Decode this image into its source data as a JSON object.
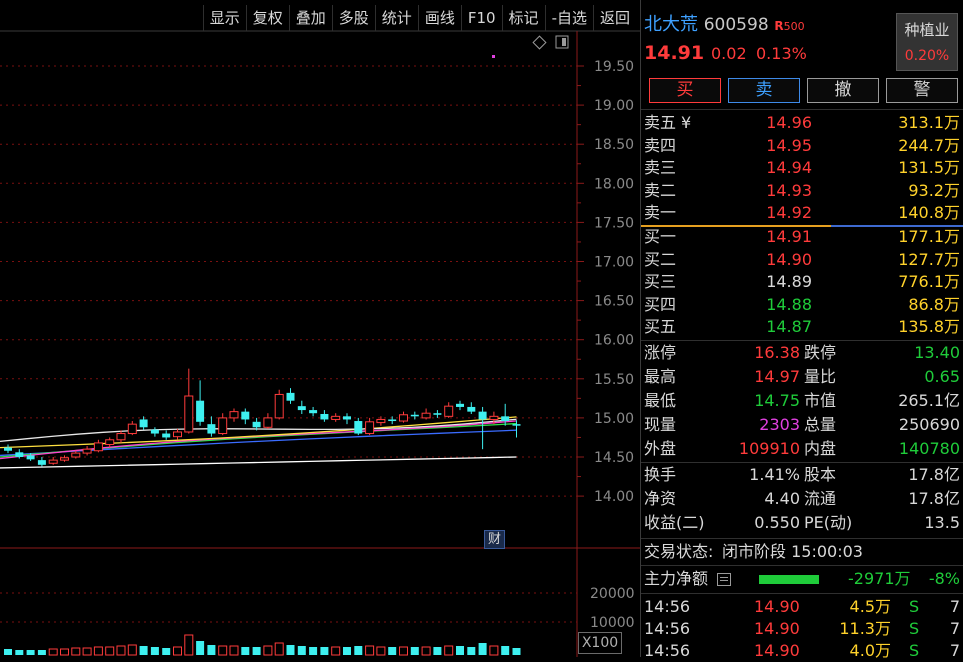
{
  "toolbar": {
    "items": [
      "显示",
      "复权",
      "叠加",
      "多股",
      "统计",
      "画线",
      "F10",
      "标记",
      "-自选",
      "返回"
    ]
  },
  "chart": {
    "price_axis": [
      "19.50",
      "19.00",
      "18.50",
      "18.00",
      "17.50",
      "17.00",
      "16.50",
      "16.00",
      "15.50",
      "15.00",
      "14.50",
      "14.00"
    ],
    "vol_axis": [
      "20000",
      "10000"
    ],
    "vol_unit": "X100",
    "badge": "财",
    "colors": {
      "up": "#ff3b3b",
      "down": "#3ef0f0"
    }
  },
  "quote": {
    "name": "北大荒",
    "code": "600598",
    "tag": "R",
    "tag_num": "500",
    "price": "14.91",
    "change": "0.02",
    "change_pct": "0.13%",
    "sector_name": "种植业",
    "sector_pct": "0.20%"
  },
  "actions": {
    "buy": "买",
    "sell": "卖",
    "cancel": "撤",
    "alert": "警"
  },
  "ask": [
    {
      "label": "卖五",
      "extra": "¥",
      "price": "14.96",
      "vol": "313.1万"
    },
    {
      "label": "卖四",
      "extra": "",
      "price": "14.95",
      "vol": "244.7万"
    },
    {
      "label": "卖三",
      "extra": "",
      "price": "14.94",
      "vol": "131.5万"
    },
    {
      "label": "卖二",
      "extra": "",
      "price": "14.93",
      "vol": "93.2万"
    },
    {
      "label": "卖一",
      "extra": "",
      "price": "14.92",
      "vol": "140.8万"
    }
  ],
  "bid": [
    {
      "label": "买一",
      "price": "14.91",
      "vol": "177.1万"
    },
    {
      "label": "买二",
      "price": "14.90",
      "vol": "127.7万"
    },
    {
      "label": "买三",
      "price": "14.89",
      "vol": "776.1万"
    },
    {
      "label": "买四",
      "price": "14.88",
      "vol": "86.8万"
    },
    {
      "label": "买五",
      "price": "14.87",
      "vol": "135.8万"
    }
  ],
  "stats": [
    {
      "l1": "涨停",
      "v1": "16.38",
      "l2": "跌停",
      "v2": "13.40"
    },
    {
      "l1": "最高",
      "v1": "14.97",
      "l2": "量比",
      "v2": "0.65"
    },
    {
      "l1": "最低",
      "v1": "14.75",
      "l2": "市值",
      "v2": "265.1亿"
    },
    {
      "l1": "现量",
      "v1": "2303",
      "l2": "总量",
      "v2": "250690"
    },
    {
      "l1": "外盘",
      "v1": "109910",
      "l2": "内盘",
      "v2": "140780"
    }
  ],
  "fundamentals": [
    {
      "l1": "换手",
      "v1": "1.41%",
      "l2": "股本",
      "v2": "17.8亿"
    },
    {
      "l1": "净资",
      "v1": "4.40",
      "l2": "流通",
      "v2": "17.8亿"
    },
    {
      "l1": "收益(二)",
      "v1": "0.550",
      "l2": "PE(动)",
      "v2": "13.5"
    }
  ],
  "status": {
    "label": "交易状态:",
    "value": "闭市阶段 15:00:03"
  },
  "mainforce": {
    "label": "主力净额",
    "value": "-2971万",
    "pct": "-8%"
  },
  "ticks": [
    {
      "time": "14:56",
      "price": "14.90",
      "vol": "4.5万",
      "side": "S",
      "num": "7"
    },
    {
      "time": "14:56",
      "price": "14.90",
      "vol": "11.3万",
      "side": "S",
      "num": "7"
    },
    {
      "time": "14:56",
      "price": "14.90",
      "vol": "4.0万",
      "side": "S",
      "num": "7"
    }
  ]
}
